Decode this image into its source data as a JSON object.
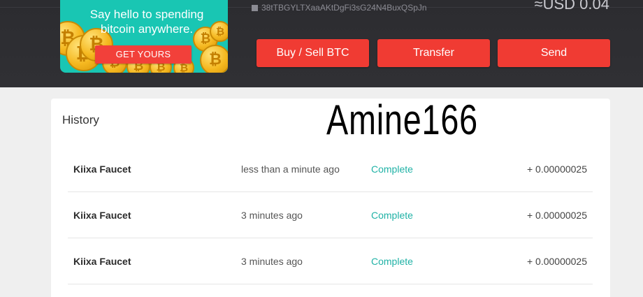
{
  "promo": {
    "headline": "Say hello to spending bitcoin anywhere.",
    "cta_label": "GET YOURS",
    "coin_symbol": "₿",
    "accent_color": "#19c6b3"
  },
  "wallet": {
    "address": "38tTBGYLTXaaAKtDgFi3sG24N4BuxQSpJn",
    "balance": "≈USD 0.04"
  },
  "actions": {
    "buy_sell": "Buy / Sell BTC",
    "transfer": "Transfer",
    "send": "Send",
    "button_color": "#f03b33"
  },
  "history": {
    "title": "History",
    "watermark": "Amine166",
    "rows": [
      {
        "name": "Kiixa Faucet",
        "time": "less than a minute ago",
        "status": "Complete",
        "amount": "+ 0.00000025"
      },
      {
        "name": "Kiixa Faucet",
        "time": "3 minutes ago",
        "status": "Complete",
        "amount": "+ 0.00000025"
      },
      {
        "name": "Kiixa Faucet",
        "time": "3 minutes ago",
        "status": "Complete",
        "amount": "+ 0.00000025"
      }
    ],
    "status_color": "#20b2a6"
  }
}
